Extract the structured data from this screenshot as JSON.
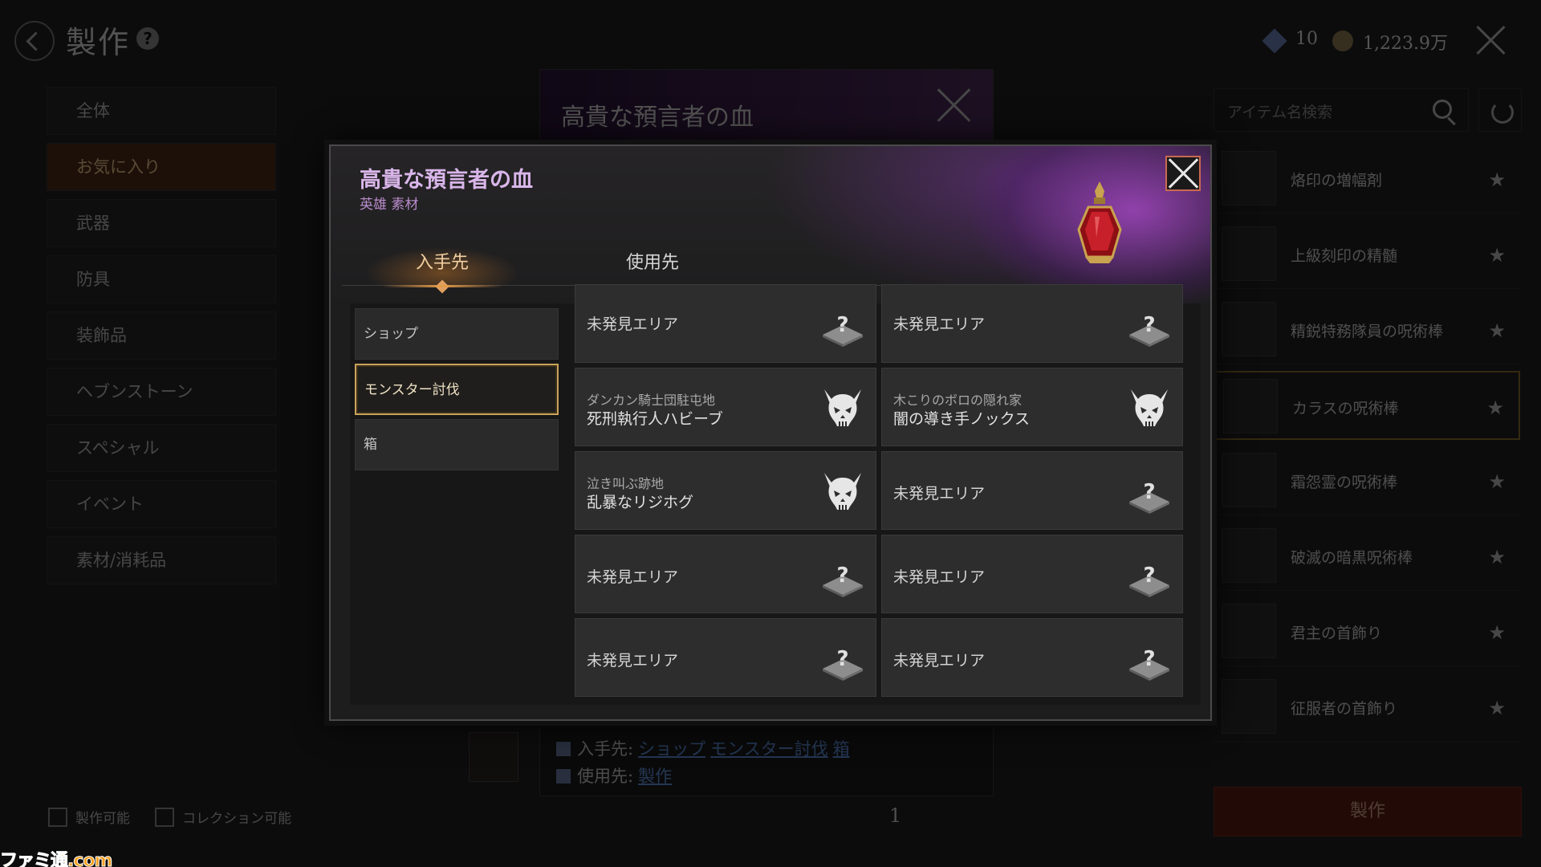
{
  "background": {
    "title": "製作",
    "help": "?",
    "currency": {
      "gems": "10",
      "gold": "1,223.9万"
    },
    "categories": [
      "全体",
      "お気に入り",
      "武器",
      "防具",
      "装飾品",
      "ヘブンストーン",
      "スペシャル",
      "イベント",
      "素材/消耗品"
    ],
    "checkboxes": [
      "製作可能",
      "コレクション可能"
    ],
    "search_placeholder": "アイテム名検索",
    "items": [
      {
        "name": "烙印の増幅剤"
      },
      {
        "name": "上級刻印の精髄"
      },
      {
        "name": "精鋭特務隊員の呪術棒"
      },
      {
        "name": "カラスの呪術棒"
      },
      {
        "name": "霜怨霊の呪術棒"
      },
      {
        "name": "破滅の暗黒呪術棒"
      },
      {
        "name": "君主の首飾り"
      },
      {
        "name": "征服者の首飾り"
      }
    ],
    "craft_button": "製作",
    "detail_title": "高貴な預言者の血",
    "source_label": "入手先:",
    "source_links": [
      "ショップ",
      "モンスター討伐",
      "箱"
    ],
    "use_label": "使用先:",
    "use_link": "製作",
    "page": "1",
    "watermark": "ファミ通.com"
  },
  "modal": {
    "title": "高貴な預言者の血",
    "subtitle": "英雄 素材",
    "tabs": [
      {
        "label": "入手先",
        "active": true
      },
      {
        "label": "使用先",
        "active": false
      }
    ],
    "categories": [
      {
        "label": "ショップ",
        "selected": false
      },
      {
        "label": "モンスター討伐",
        "selected": true
      },
      {
        "label": "箱",
        "selected": false
      }
    ],
    "entries": [
      {
        "area": "",
        "name": "未発見エリア",
        "icon": "unknown-area-icon"
      },
      {
        "area": "",
        "name": "未発見エリア",
        "icon": "unknown-area-icon"
      },
      {
        "area": "ダンカン騎士団駐屯地",
        "name": "死刑執行人ハビーブ",
        "icon": "monster-skull-icon"
      },
      {
        "area": "木こりのボロの隠れ家",
        "name": "闇の導き手ノックス",
        "icon": "monster-skull-icon"
      },
      {
        "area": "泣き叫ぶ跡地",
        "name": "乱暴なリジホグ",
        "icon": "monster-skull-icon"
      },
      {
        "area": "",
        "name": "未発見エリア",
        "icon": "unknown-area-icon"
      },
      {
        "area": "",
        "name": "未発見エリア",
        "icon": "unknown-area-icon"
      },
      {
        "area": "",
        "name": "未発見エリア",
        "icon": "unknown-area-icon"
      },
      {
        "area": "",
        "name": "未発見エリア",
        "icon": "unknown-area-icon"
      },
      {
        "area": "",
        "name": "未発見エリア",
        "icon": "unknown-area-icon"
      }
    ]
  },
  "colors": {
    "accent_gold": "#c9a25a",
    "title_purple": "#d9b6ea",
    "close_border": "#c96a52"
  }
}
